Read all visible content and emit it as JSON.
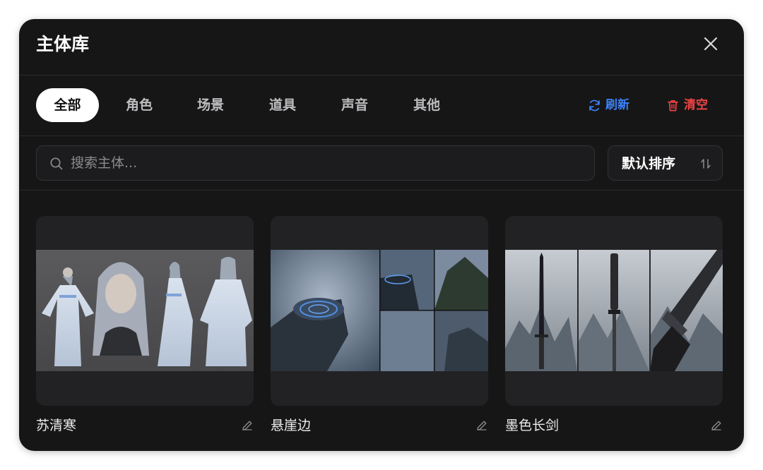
{
  "title": "主体库",
  "tabs": [
    {
      "label": "全部",
      "active": true
    },
    {
      "label": "角色"
    },
    {
      "label": "场景"
    },
    {
      "label": "道具"
    },
    {
      "label": "声音"
    },
    {
      "label": "其他"
    }
  ],
  "actions": {
    "refresh": {
      "label": "刷新",
      "color": "#3d82f6",
      "icon": "refresh-icon"
    },
    "clear": {
      "label": "清空",
      "color": "#ef4444",
      "icon": "trash-icon"
    }
  },
  "search": {
    "placeholder": "搜索主体...",
    "value": ""
  },
  "sort": {
    "label": "默认排序",
    "icon": "sort-arrows-icon"
  },
  "cards": [
    {
      "name": "苏清寒",
      "image": "character-turnaround-image",
      "icon": "edit-pencil-icon"
    },
    {
      "name": "悬崖边",
      "image": "cliff-scene-image",
      "icon": "edit-pencil-icon"
    },
    {
      "name": "墨色长剑",
      "image": "black-sword-image",
      "icon": "edit-pencil-icon"
    }
  ],
  "colors": {
    "background": "#161617",
    "accent_blue": "#3d82f6",
    "accent_red": "#ef4444"
  }
}
